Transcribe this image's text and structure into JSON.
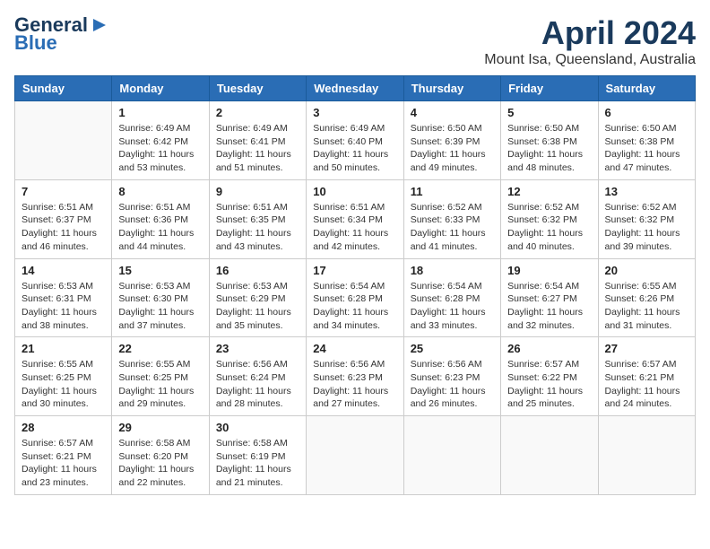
{
  "header": {
    "logo_line1": "General",
    "logo_line2": "Blue",
    "month": "April 2024",
    "location": "Mount Isa, Queensland, Australia"
  },
  "weekdays": [
    "Sunday",
    "Monday",
    "Tuesday",
    "Wednesday",
    "Thursday",
    "Friday",
    "Saturday"
  ],
  "weeks": [
    [
      {
        "day": "",
        "sunrise": "",
        "sunset": "",
        "daylight": ""
      },
      {
        "day": "1",
        "sunrise": "Sunrise: 6:49 AM",
        "sunset": "Sunset: 6:42 PM",
        "daylight": "Daylight: 11 hours and 53 minutes."
      },
      {
        "day": "2",
        "sunrise": "Sunrise: 6:49 AM",
        "sunset": "Sunset: 6:41 PM",
        "daylight": "Daylight: 11 hours and 51 minutes."
      },
      {
        "day": "3",
        "sunrise": "Sunrise: 6:49 AM",
        "sunset": "Sunset: 6:40 PM",
        "daylight": "Daylight: 11 hours and 50 minutes."
      },
      {
        "day": "4",
        "sunrise": "Sunrise: 6:50 AM",
        "sunset": "Sunset: 6:39 PM",
        "daylight": "Daylight: 11 hours and 49 minutes."
      },
      {
        "day": "5",
        "sunrise": "Sunrise: 6:50 AM",
        "sunset": "Sunset: 6:38 PM",
        "daylight": "Daylight: 11 hours and 48 minutes."
      },
      {
        "day": "6",
        "sunrise": "Sunrise: 6:50 AM",
        "sunset": "Sunset: 6:38 PM",
        "daylight": "Daylight: 11 hours and 47 minutes."
      }
    ],
    [
      {
        "day": "7",
        "sunrise": "Sunrise: 6:51 AM",
        "sunset": "Sunset: 6:37 PM",
        "daylight": "Daylight: 11 hours and 46 minutes."
      },
      {
        "day": "8",
        "sunrise": "Sunrise: 6:51 AM",
        "sunset": "Sunset: 6:36 PM",
        "daylight": "Daylight: 11 hours and 44 minutes."
      },
      {
        "day": "9",
        "sunrise": "Sunrise: 6:51 AM",
        "sunset": "Sunset: 6:35 PM",
        "daylight": "Daylight: 11 hours and 43 minutes."
      },
      {
        "day": "10",
        "sunrise": "Sunrise: 6:51 AM",
        "sunset": "Sunset: 6:34 PM",
        "daylight": "Daylight: 11 hours and 42 minutes."
      },
      {
        "day": "11",
        "sunrise": "Sunrise: 6:52 AM",
        "sunset": "Sunset: 6:33 PM",
        "daylight": "Daylight: 11 hours and 41 minutes."
      },
      {
        "day": "12",
        "sunrise": "Sunrise: 6:52 AM",
        "sunset": "Sunset: 6:32 PM",
        "daylight": "Daylight: 11 hours and 40 minutes."
      },
      {
        "day": "13",
        "sunrise": "Sunrise: 6:52 AM",
        "sunset": "Sunset: 6:32 PM",
        "daylight": "Daylight: 11 hours and 39 minutes."
      }
    ],
    [
      {
        "day": "14",
        "sunrise": "Sunrise: 6:53 AM",
        "sunset": "Sunset: 6:31 PM",
        "daylight": "Daylight: 11 hours and 38 minutes."
      },
      {
        "day": "15",
        "sunrise": "Sunrise: 6:53 AM",
        "sunset": "Sunset: 6:30 PM",
        "daylight": "Daylight: 11 hours and 37 minutes."
      },
      {
        "day": "16",
        "sunrise": "Sunrise: 6:53 AM",
        "sunset": "Sunset: 6:29 PM",
        "daylight": "Daylight: 11 hours and 35 minutes."
      },
      {
        "day": "17",
        "sunrise": "Sunrise: 6:54 AM",
        "sunset": "Sunset: 6:28 PM",
        "daylight": "Daylight: 11 hours and 34 minutes."
      },
      {
        "day": "18",
        "sunrise": "Sunrise: 6:54 AM",
        "sunset": "Sunset: 6:28 PM",
        "daylight": "Daylight: 11 hours and 33 minutes."
      },
      {
        "day": "19",
        "sunrise": "Sunrise: 6:54 AM",
        "sunset": "Sunset: 6:27 PM",
        "daylight": "Daylight: 11 hours and 32 minutes."
      },
      {
        "day": "20",
        "sunrise": "Sunrise: 6:55 AM",
        "sunset": "Sunset: 6:26 PM",
        "daylight": "Daylight: 11 hours and 31 minutes."
      }
    ],
    [
      {
        "day": "21",
        "sunrise": "Sunrise: 6:55 AM",
        "sunset": "Sunset: 6:25 PM",
        "daylight": "Daylight: 11 hours and 30 minutes."
      },
      {
        "day": "22",
        "sunrise": "Sunrise: 6:55 AM",
        "sunset": "Sunset: 6:25 PM",
        "daylight": "Daylight: 11 hours and 29 minutes."
      },
      {
        "day": "23",
        "sunrise": "Sunrise: 6:56 AM",
        "sunset": "Sunset: 6:24 PM",
        "daylight": "Daylight: 11 hours and 28 minutes."
      },
      {
        "day": "24",
        "sunrise": "Sunrise: 6:56 AM",
        "sunset": "Sunset: 6:23 PM",
        "daylight": "Daylight: 11 hours and 27 minutes."
      },
      {
        "day": "25",
        "sunrise": "Sunrise: 6:56 AM",
        "sunset": "Sunset: 6:23 PM",
        "daylight": "Daylight: 11 hours and 26 minutes."
      },
      {
        "day": "26",
        "sunrise": "Sunrise: 6:57 AM",
        "sunset": "Sunset: 6:22 PM",
        "daylight": "Daylight: 11 hours and 25 minutes."
      },
      {
        "day": "27",
        "sunrise": "Sunrise: 6:57 AM",
        "sunset": "Sunset: 6:21 PM",
        "daylight": "Daylight: 11 hours and 24 minutes."
      }
    ],
    [
      {
        "day": "28",
        "sunrise": "Sunrise: 6:57 AM",
        "sunset": "Sunset: 6:21 PM",
        "daylight": "Daylight: 11 hours and 23 minutes."
      },
      {
        "day": "29",
        "sunrise": "Sunrise: 6:58 AM",
        "sunset": "Sunset: 6:20 PM",
        "daylight": "Daylight: 11 hours and 22 minutes."
      },
      {
        "day": "30",
        "sunrise": "Sunrise: 6:58 AM",
        "sunset": "Sunset: 6:19 PM",
        "daylight": "Daylight: 11 hours and 21 minutes."
      },
      {
        "day": "",
        "sunrise": "",
        "sunset": "",
        "daylight": ""
      },
      {
        "day": "",
        "sunrise": "",
        "sunset": "",
        "daylight": ""
      },
      {
        "day": "",
        "sunrise": "",
        "sunset": "",
        "daylight": ""
      },
      {
        "day": "",
        "sunrise": "",
        "sunset": "",
        "daylight": ""
      }
    ]
  ]
}
